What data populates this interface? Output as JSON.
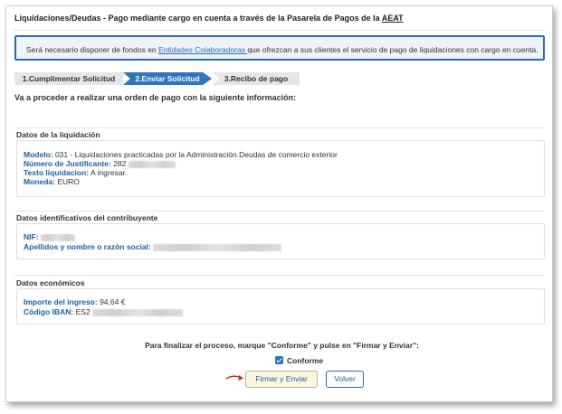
{
  "header": {
    "title_main": "Liquidaciones/Deudas - Pago mediante cargo en cuenta a través de la Pasarela de Pagos de la",
    "title_aeat": "AEAT"
  },
  "info": {
    "text_before": "Será necesario disponer de fondos en",
    "link": "Entidades Colaboradoras ",
    "text_after": "que ofrezcan a sus clientes el servicio de pago de liquidaciones con cargo en cuenta."
  },
  "steps": [
    {
      "label": "1.Cumplimentar Solicitud"
    },
    {
      "label": "2.Enviar Solicitud"
    },
    {
      "label": "3.Recibo de pago"
    }
  ],
  "lead": "Va a proceder a realizar una orden de pago con la siguiente información:",
  "liquidacion": {
    "title": "Datos de la liquidación",
    "modelo_label": "Modelo:",
    "modelo_value": " 031 - Liquidaciones practicadas por la Administración.Deudas de comercio exterior",
    "justificante_label": "Número de Justificante:",
    "justificante_value": " 282",
    "texto_label": "Texto liquidacion:",
    "texto_value": " A ingresar.",
    "moneda_label": "Moneda:",
    "moneda_value": " EURO"
  },
  "contribuyente": {
    "title": "Datos identificativos del contribuyente",
    "nif_label": "NIF:",
    "nombre_label": "Apellidos y nombre o razón social:"
  },
  "economicos": {
    "title": "Datos económicos",
    "importe_label": "Importe del ingreso:",
    "importe_value": " 94,64 €",
    "iban_label": "Código IBAN:",
    "iban_value": " ES2"
  },
  "final_text": "Para finalizar el proceso, marque \"Conforme\" y pulse en \"Firmar y Enviar\":",
  "conforme": {
    "label": "Conforme",
    "checked": true
  },
  "buttons": {
    "firmar": "Firmar y Enviar",
    "volver": "Volver"
  },
  "colors": {
    "accent": "#2f74c0",
    "label_blue": "#1f5fa8",
    "arrow_red": "#d42020"
  }
}
